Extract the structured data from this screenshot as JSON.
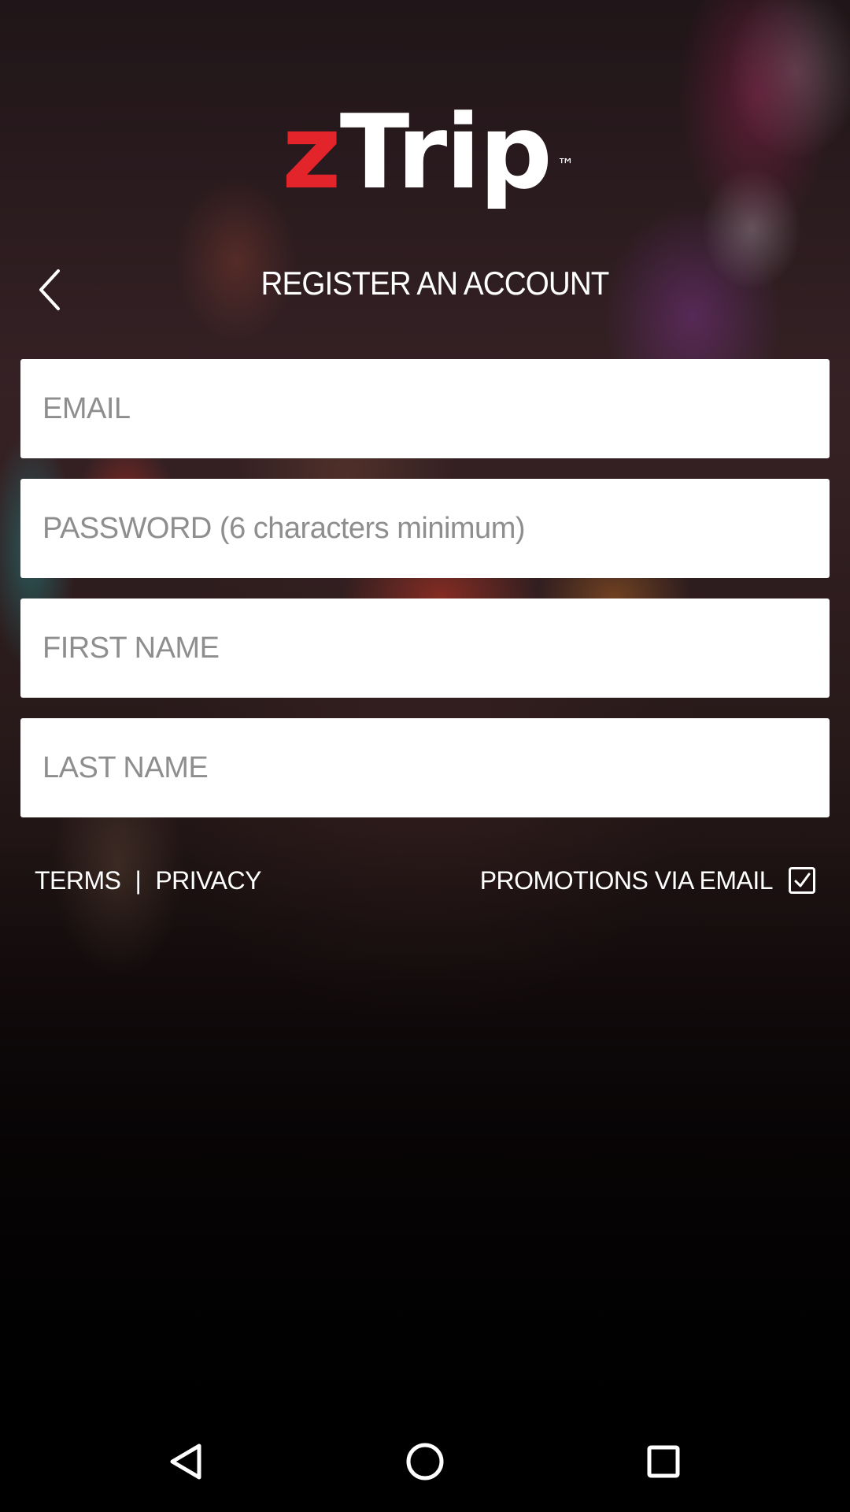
{
  "app": {
    "logo_z": "z",
    "logo_rest": "Trip",
    "logo_tm": "™",
    "brand_red": "#e3242b"
  },
  "header": {
    "title": "REGISTER AN ACCOUNT",
    "back_icon": "chevron-left-icon"
  },
  "form": {
    "email_placeholder": "EMAIL",
    "email_value": "",
    "password_placeholder": "PASSWORD (6 characters minimum)",
    "password_value": "",
    "first_name_placeholder": "FIRST NAME",
    "first_name_value": "",
    "last_name_placeholder": "LAST NAME",
    "last_name_value": ""
  },
  "footer": {
    "terms_label": "TERMS",
    "separator": "|",
    "privacy_label": "PRIVACY",
    "promotions_label": "PROMOTIONS VIA EMAIL",
    "promotions_checked": true
  },
  "system_nav": {
    "back_icon": "triangle-back-icon",
    "home_icon": "circle-home-icon",
    "recents_icon": "square-recents-icon"
  }
}
